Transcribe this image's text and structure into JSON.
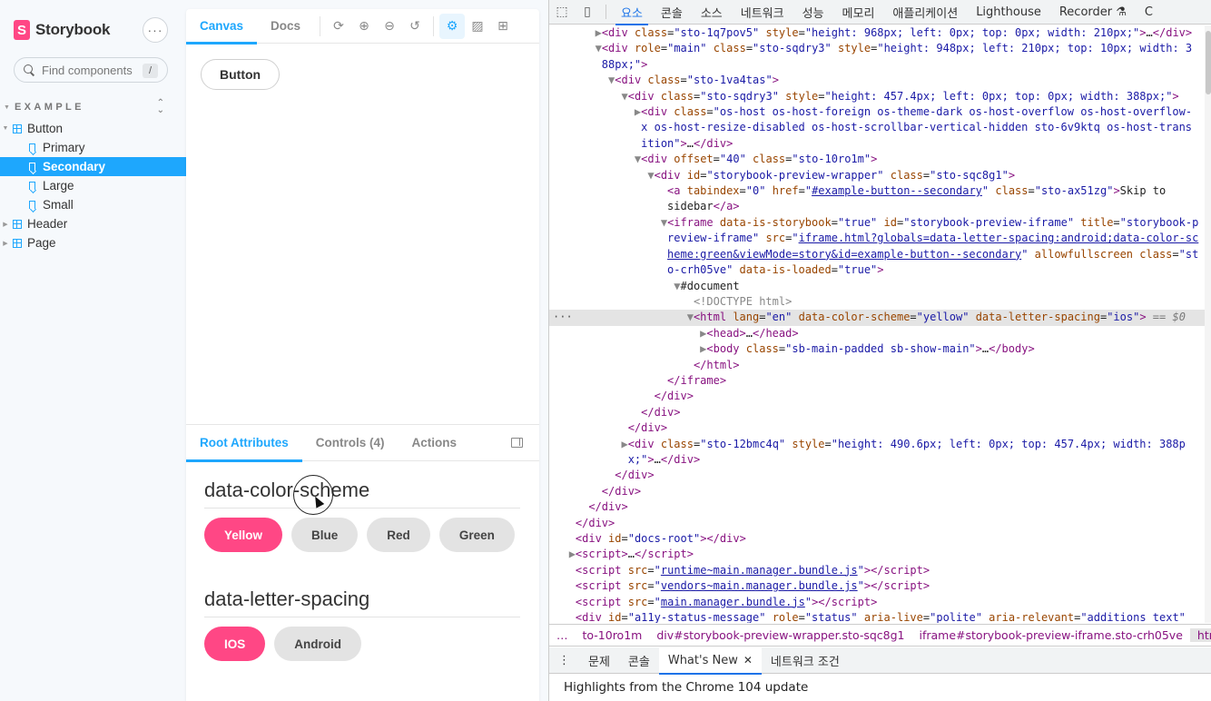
{
  "sidebar": {
    "brand": "Storybook",
    "brand_mark": "S",
    "menu_glyph": "···",
    "search": {
      "placeholder": "Find components",
      "shortcut": "/"
    },
    "group_title": "EXAMPLE",
    "tree": [
      {
        "label": "Button",
        "kind": "component",
        "expanded": true
      },
      {
        "label": "Primary",
        "kind": "story"
      },
      {
        "label": "Secondary",
        "kind": "story",
        "selected": true
      },
      {
        "label": "Large",
        "kind": "story"
      },
      {
        "label": "Small",
        "kind": "story"
      },
      {
        "label": "Header",
        "kind": "component",
        "expanded": false
      },
      {
        "label": "Page",
        "kind": "component",
        "expanded": false
      }
    ]
  },
  "preview": {
    "tabs": [
      "Canvas",
      "Docs"
    ],
    "toolbar_icons": [
      "reload-icon",
      "zoom-in-icon",
      "zoom-out-icon",
      "zoom-reset-icon",
      "settings-icon",
      "image-icon",
      "grid-icon"
    ],
    "story_button_label": "Button"
  },
  "addons": {
    "tabs": [
      "Root Attributes",
      "Controls (4)",
      "Actions"
    ],
    "attributes": [
      {
        "name": "data-color-scheme",
        "options": [
          "Yellow",
          "Blue",
          "Red",
          "Green"
        ],
        "selected": "Yellow"
      },
      {
        "name": "data-letter-spacing",
        "options": [
          "IOS",
          "Android"
        ],
        "selected": "IOS"
      }
    ]
  },
  "devtools": {
    "tabs": [
      "요소",
      "콘솔",
      "소스",
      "네트워크",
      "성능",
      "메모리",
      "애플리케이션",
      "Lighthouse",
      "Recorder ⚗",
      "C"
    ],
    "active_tab": "요소",
    "breadcrumbs": [
      "…",
      "to-10ro1m",
      "div#storybook-preview-wrapper.sto-sqc8g1",
      "iframe#storybook-preview-iframe.sto-crh05ve",
      "html"
    ],
    "drawer_tabs": [
      "문제",
      "콘솔",
      "What's New",
      "네트워크 조건"
    ],
    "drawer_active": "What's New",
    "whats_new_text": "Highlights from the Chrome 104 update"
  },
  "colors": {
    "accent": "#1ea7fd",
    "selected_option": "#ff4785",
    "devtools_tag": "#881280",
    "devtools_attr": "#994500",
    "devtools_value": "#1a1aa6"
  }
}
